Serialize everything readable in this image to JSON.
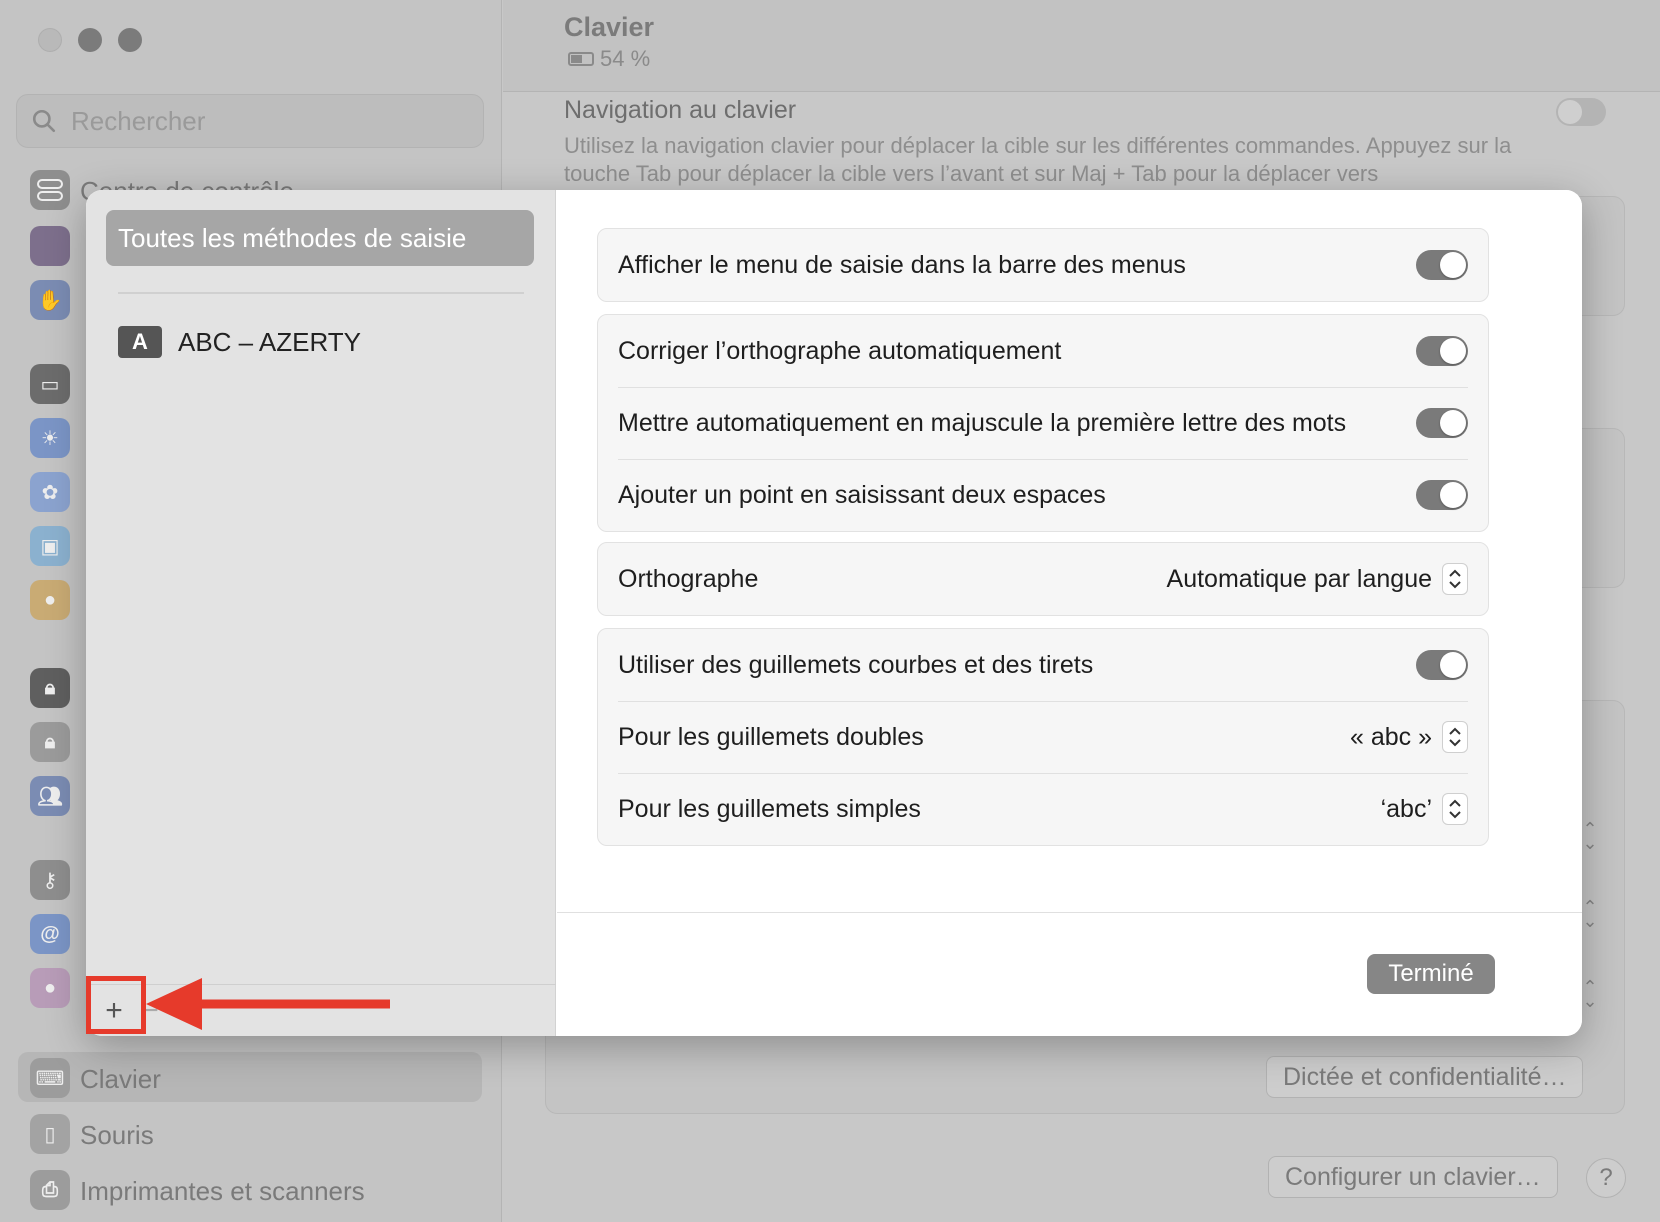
{
  "background": {
    "search_placeholder": "Rechercher",
    "sidebar_items": [
      {
        "label": "Centre de contrôle"
      },
      {
        "label": "Clavier"
      },
      {
        "label": "Souris"
      },
      {
        "label": "Imprimantes et scanners"
      }
    ],
    "header": {
      "title": "Clavier",
      "battery": "54 %"
    },
    "keyboard_nav": {
      "title": "Navigation au clavier",
      "description": "Utilisez la navigation clavier pour déplacer la cible sur les différentes commandes. Appuyez sur la touche Tab pour déplacer la cible vers l’avant et sur Maj + Tab pour la déplacer vers"
    },
    "buttons": {
      "dictation_privacy": "Dictée et confidentialité…",
      "configure_keyboard": "Configurer un clavier…",
      "help": "?"
    }
  },
  "sheet": {
    "sidebar": {
      "all_methods": "Toutes les méthodes de saisie",
      "input_sources": [
        {
          "badge": "A",
          "label": "ABC – AZERTY"
        }
      ],
      "add": "+",
      "remove": "−"
    },
    "groups": [
      {
        "rows": [
          {
            "label": "Afficher le menu de saisie dans la barre des menus",
            "control": "toggle",
            "on": true
          }
        ]
      },
      {
        "rows": [
          {
            "label": "Corriger l’orthographe automatiquement",
            "control": "toggle",
            "on": true
          },
          {
            "label": "Mettre automatiquement en majuscule la première lettre des mots",
            "control": "toggle",
            "on": true
          },
          {
            "label": "Ajouter un point en saisissant deux espaces",
            "control": "toggle",
            "on": true
          }
        ]
      },
      {
        "rows": [
          {
            "label": "Orthographe",
            "control": "popup",
            "value": "Automatique par langue"
          }
        ]
      },
      {
        "rows": [
          {
            "label": "Utiliser des guillemets courbes et des tirets",
            "control": "toggle",
            "on": true
          },
          {
            "label": "Pour les guillemets doubles",
            "control": "popup",
            "value": "« abc »"
          },
          {
            "label": "Pour les guillemets simples",
            "control": "popup",
            "value": "‘abc’"
          }
        ]
      }
    ],
    "done_label": "Terminé"
  },
  "colors": {
    "annotation": "#e63a2b",
    "toggle_on": "#7a7a7a",
    "primary_button": "#868686"
  }
}
